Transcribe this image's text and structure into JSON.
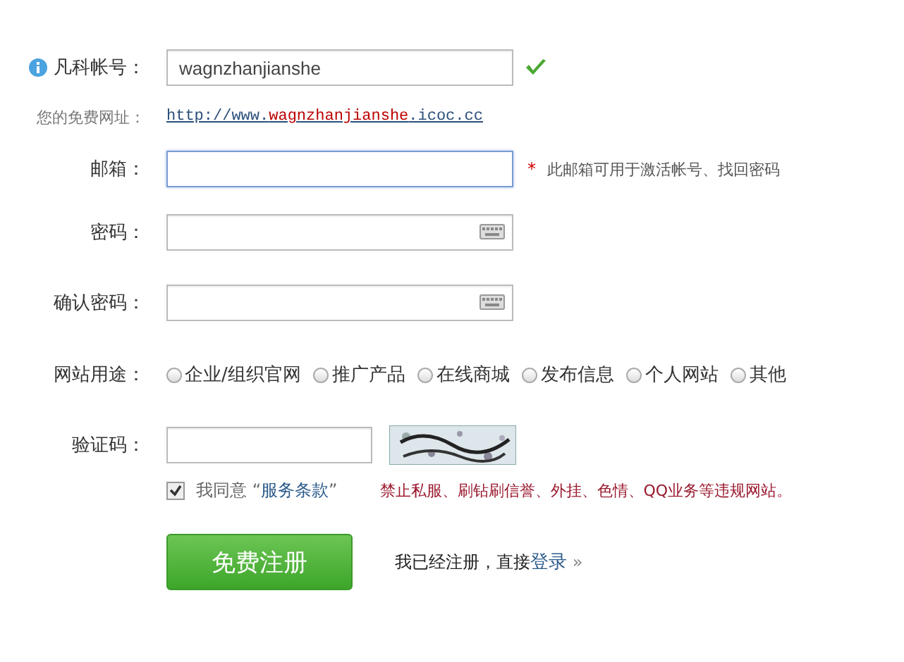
{
  "fields": [
    {
      "kind": "text",
      "label": "凡科帐号：",
      "value": "wagnzhanjianshe",
      "info": true,
      "valid": true,
      "focused": false
    },
    {
      "kind": "url",
      "label": "您的免费网址：",
      "url_prefix": "http://www.",
      "url_name": "wagnzhanjianshe",
      "url_suffix": ".icoc.cc"
    },
    {
      "kind": "text",
      "label": "邮箱：",
      "info": false,
      "valid": false,
      "focused": true,
      "required_mark": "*",
      "hint": "此邮箱可用于激活帐号、找回密码"
    },
    {
      "kind": "password",
      "label": "密码：",
      "focused": false
    },
    {
      "kind": "password",
      "label": "确认密码：",
      "focused": false
    },
    {
      "kind": "radios",
      "label": "网站用途：",
      "options": [
        {
          "label": "企业/组织官网",
          "selected": false
        },
        {
          "label": "推广产品",
          "selected": false
        },
        {
          "label": "在线商城",
          "selected": false
        },
        {
          "label": "发布信息",
          "selected": false
        },
        {
          "label": "个人网站",
          "selected": false
        },
        {
          "label": "其他",
          "selected": false
        }
      ]
    },
    {
      "kind": "captcha",
      "label": "验证码："
    }
  ],
  "agreement": {
    "checked": true,
    "prefix": "我同意",
    "quote_open": "“",
    "link": "服务条款",
    "quote_close": "”",
    "warning": "禁止私服、刷钻刷信誉、外挂、色情、QQ业务等违规网站。"
  },
  "submit": {
    "label": "免费注册"
  },
  "login": {
    "prefix": "我已经注册，直接",
    "link": "登录",
    "suffix": "»"
  }
}
